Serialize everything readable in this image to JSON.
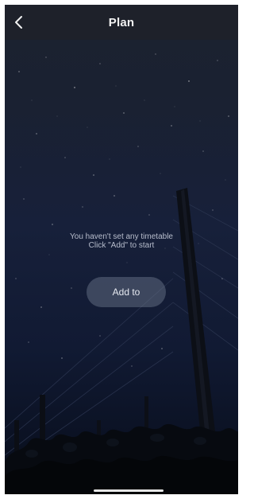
{
  "header": {
    "title": "Plan",
    "back_icon": "chevron-left-icon"
  },
  "empty_state": {
    "line1": "You haven't set any timetable",
    "line2": "Click \"Add\" to start"
  },
  "actions": {
    "add_label": "Add to"
  },
  "colors": {
    "header_bg": "#1e212a",
    "sky_top": "#1c2230",
    "sky_bottom": "#070b15",
    "button_bg": "rgba(120,130,150,0.42)"
  }
}
